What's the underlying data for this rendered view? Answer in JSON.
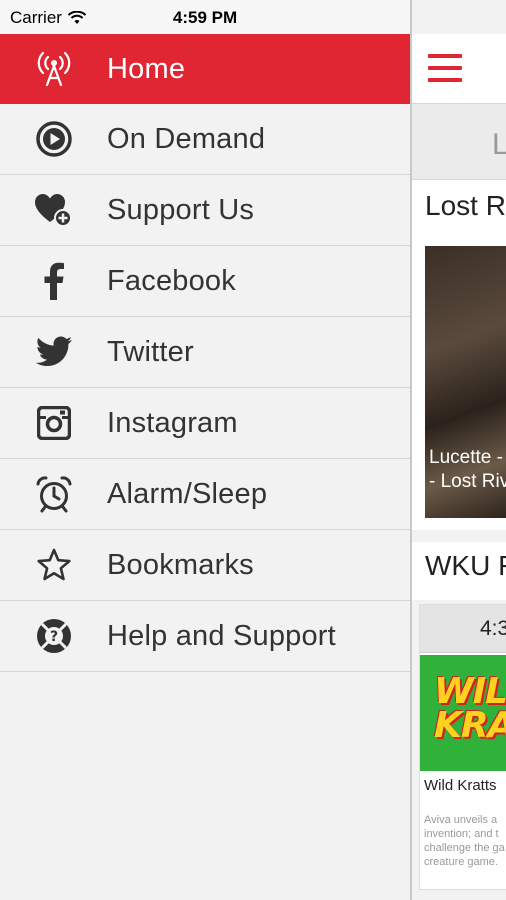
{
  "status_bar": {
    "carrier": "Carrier",
    "time": "4:59 PM"
  },
  "menu": {
    "items": [
      {
        "label": "Home",
        "icon": "radio-tower-icon",
        "active": true
      },
      {
        "label": "On Demand",
        "icon": "play-circle-icon"
      },
      {
        "label": "Support Us",
        "icon": "heart-plus-icon"
      },
      {
        "label": "Facebook",
        "icon": "facebook-icon"
      },
      {
        "label": "Twitter",
        "icon": "twitter-icon"
      },
      {
        "label": "Instagram",
        "icon": "instagram-icon"
      },
      {
        "label": "Alarm/Sleep",
        "icon": "alarm-clock-icon"
      },
      {
        "label": "Bookmarks",
        "icon": "star-icon"
      },
      {
        "label": "Help and Support",
        "icon": "lifebuoy-icon"
      }
    ]
  },
  "content": {
    "tab_partial": "L",
    "section1_title": "Lost R",
    "card_caption_line1": "Lucette -",
    "card_caption_line2": "- Lost Riv",
    "section2_title": "WKU F",
    "schedule_time": "4:3",
    "thumb_logo_line1": "WILD",
    "thumb_logo_line2": "KRATTS",
    "show_title": "Wild Kratts",
    "show_desc_lines": [
      "Aviva unveils a",
      "invention; and t",
      "challenge the ga",
      "creature game."
    ]
  },
  "colors": {
    "accent": "#e02633",
    "menu_bg": "#f2f2f2",
    "menu_text": "#333333"
  }
}
